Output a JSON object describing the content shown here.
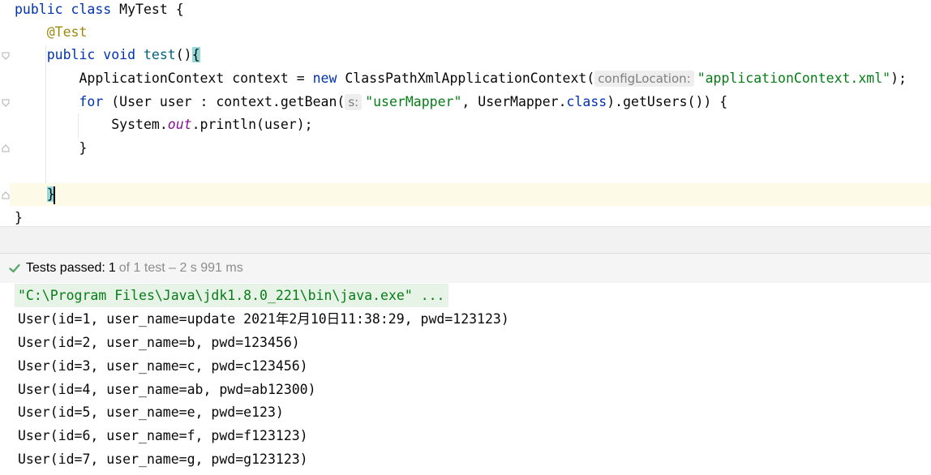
{
  "editor": {
    "lines": {
      "l1": {
        "kw1": "public",
        "kw2": "class",
        "name": "MyTest",
        "brace": "{"
      },
      "l2": {
        "annotation": "@Test"
      },
      "l3": {
        "kw1": "public",
        "kw2": "void",
        "method": "test",
        "parens": "()",
        "brace": "{"
      },
      "l4": {
        "type": "ApplicationContext context = ",
        "kw": "new",
        "ctor": "ClassPathXmlApplicationContext(",
        "hint": "configLocation:",
        "str": "\"applicationContext.xml\"",
        "end": ");"
      },
      "l5": {
        "kw": "for",
        "mid": " (User user : context.getBean(",
        "hint": "s:",
        "str": "\"userMapper\"",
        "mid2": ", UserMapper.",
        "kw2": "class",
        "end": ").getUsers()) {"
      },
      "l6": {
        "pre": "System.",
        "field": "out",
        "post": ".println(user);"
      },
      "l7": {
        "brace": "}"
      },
      "l9": {
        "brace": "}"
      },
      "l10": {
        "brace": "}"
      }
    }
  },
  "test_status": {
    "label": "Tests passed:",
    "count": "1",
    "detail": "of 1 test – 2 s 991 ms"
  },
  "console": {
    "command": "\"C:\\Program Files\\Java\\jdk1.8.0_221\\bin\\java.exe\" ...",
    "output": [
      "User(id=1, user_name=update 2021年2月10日11:38:29, pwd=123123)",
      "User(id=2, user_name=b, pwd=123456)",
      "User(id=3, user_name=c, pwd=c123456)",
      "User(id=4, user_name=ab, pwd=ab12300)",
      "User(id=5, user_name=e, pwd=e123)",
      "User(id=6, user_name=f, pwd=f123123)",
      "User(id=7, user_name=g, pwd=g123123)"
    ]
  },
  "colors": {
    "keyword": "#0033b3",
    "annotation": "#9e880d",
    "string": "#067d17",
    "method": "#00627a",
    "static_field": "#871094",
    "pass_green": "#59a869"
  },
  "icons": [
    "fold-marker-icon",
    "check-icon"
  ]
}
